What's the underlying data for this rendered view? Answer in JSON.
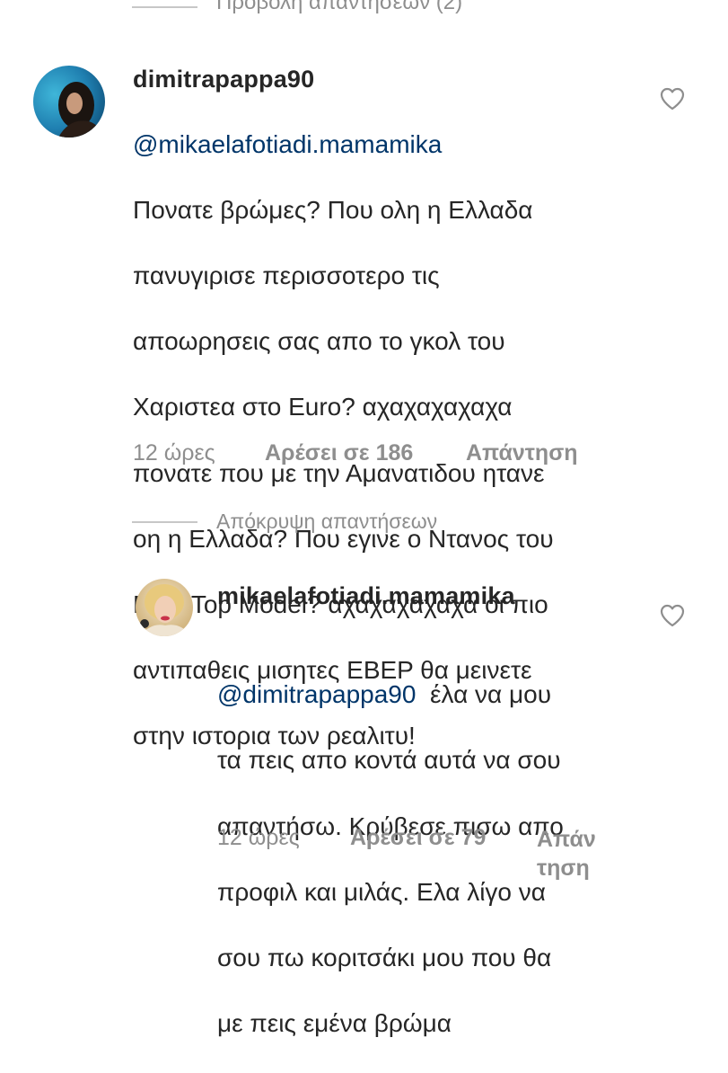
{
  "top_toggle": {
    "label": "Προβολή απαντήσεων (2)"
  },
  "comment_main": {
    "username": "dimitrapappa90",
    "mention": "@mikaelafotiadi.mamamika",
    "lines": [
      "Πονατε βρώμες? Που ολη η Ελλαδα",
      "πανυγιρισε περισσοτερο τις",
      "αποωρησεις σας απο το γκολ του",
      "Χαριστεα στο Euro? αχαχαχαχαχα",
      "πονατε που με την Αμανατιδου ητανε",
      "οη η Ελλαδα? Που εγινε ο Ντανος του",
      "Next Top Model? αχαχαχαχαχα οι πιο",
      "αντιπαθεις μισητες ΕΒΕΡ θα μεινετε",
      "στην ιστορια των ρεαλιτυ!"
    ],
    "time": "12 ώρες",
    "likes": "Αρέσει σε 186",
    "reply": "Απάντηση"
  },
  "hide_toggle": {
    "label": "Απόκρυψη απαντήσεων"
  },
  "comment_reply": {
    "username": "mikaelafotiadi.mamamika",
    "mention": "@dimitrapappa90",
    "first_line_rest": "έλα να μου",
    "lines": [
      "τα πεις απο κοντά αυτά να σου",
      "απαντήσω. Κρύβεσε πισω απο",
      "προφιλ και μιλάς. Ελα λίγο να",
      "σου πω κοριτσάκι μου που θα",
      "με πεις εμένα βρώμα"
    ],
    "time": "12 ώρες",
    "likes": "Αρέσει σε 79",
    "reply_line1": "Απάν",
    "reply_line2": "τηση"
  },
  "icons": {
    "like": "heart-outline-icon"
  },
  "colors": {
    "text": "#262626",
    "secondary": "#8e8e8e",
    "mention": "#003569",
    "divider": "#c7c7c7"
  }
}
